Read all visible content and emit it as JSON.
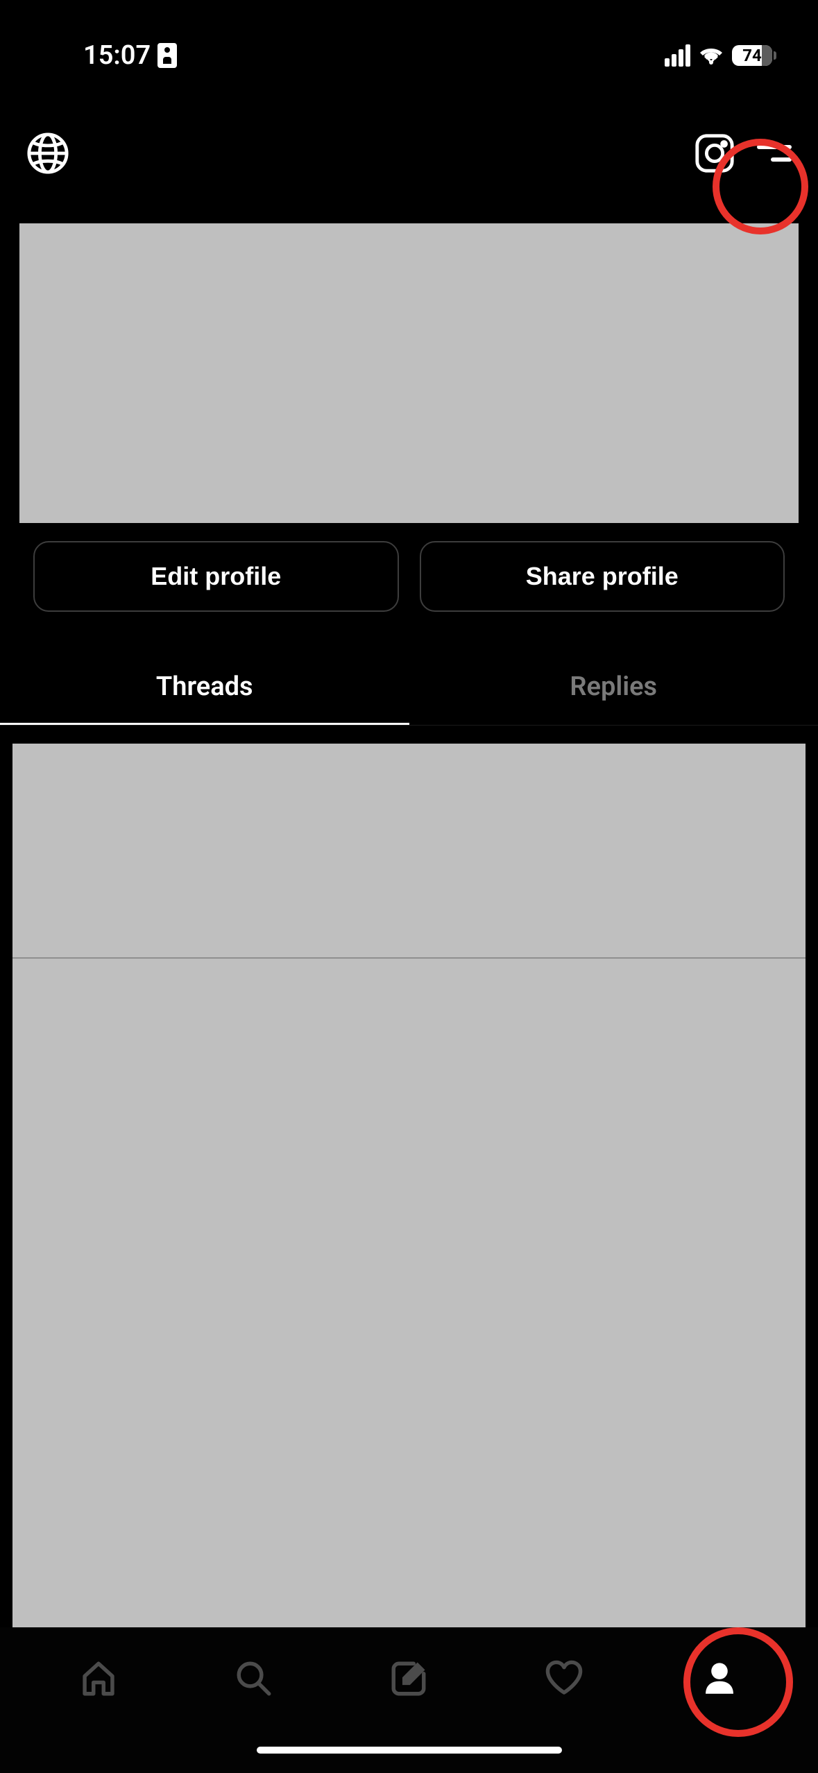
{
  "statusBar": {
    "time": "15:07",
    "batteryPercent": "74"
  },
  "actions": {
    "editProfile": "Edit profile",
    "shareProfile": "Share profile"
  },
  "tabs": {
    "threads": "Threads",
    "replies": "Replies"
  }
}
